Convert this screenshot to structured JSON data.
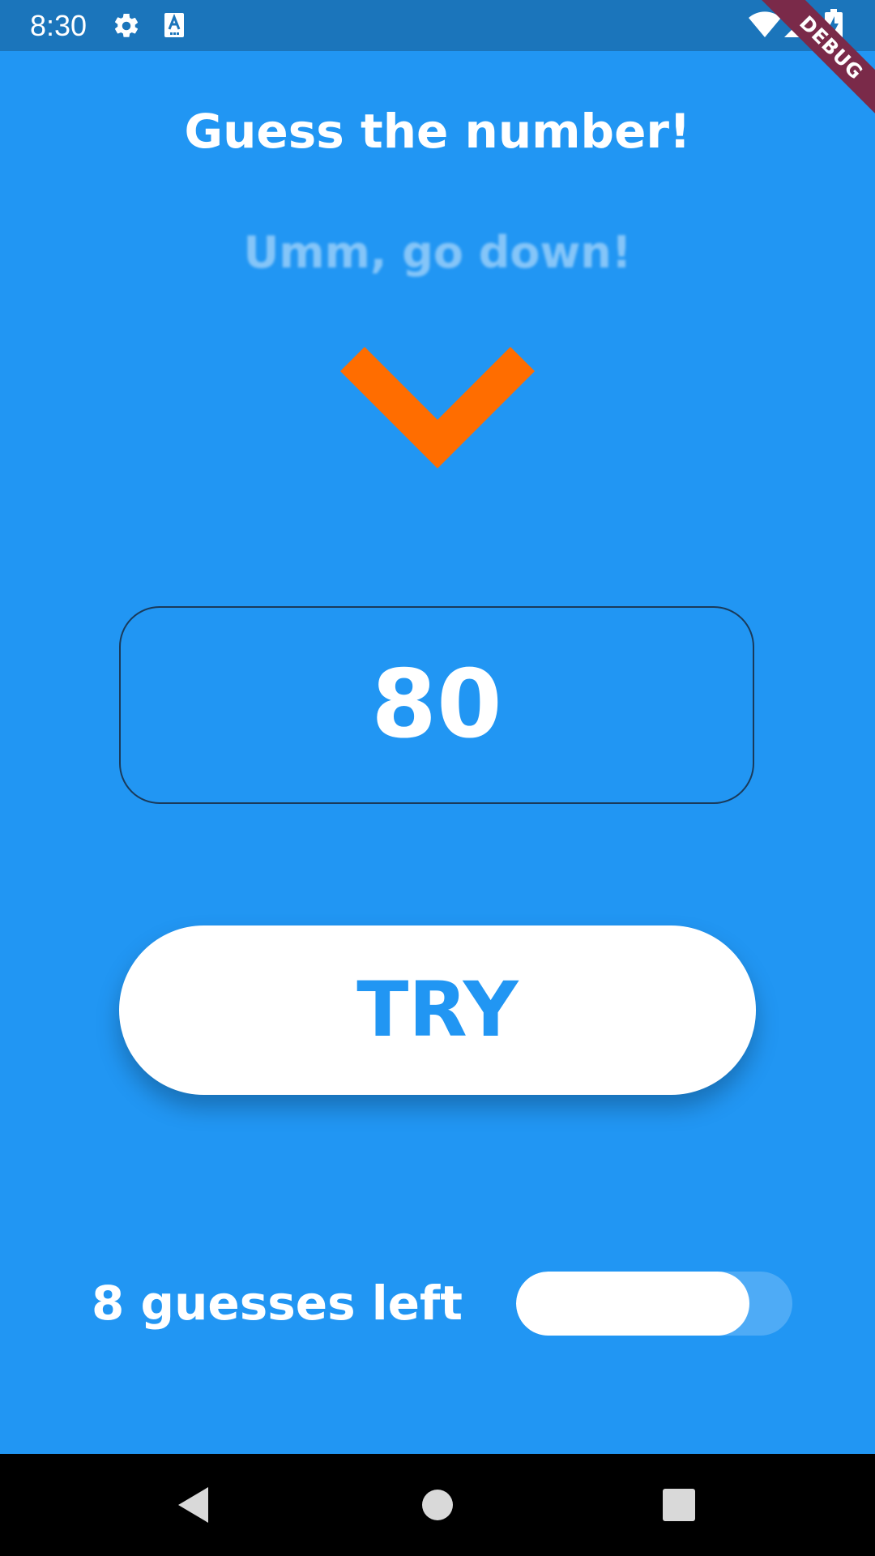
{
  "status_bar": {
    "time": "8:30",
    "icons": [
      "gear-icon",
      "keyboard-a-icon",
      "wifi-icon",
      "signal-icon",
      "battery-charging-icon"
    ]
  },
  "debug_banner": "DEBUG",
  "title": "Guess the number!",
  "hint": "Umm, go down!",
  "hint_icon": "chevron-down-icon",
  "guess_input": {
    "value": "80"
  },
  "try_button": {
    "label": "TRY"
  },
  "guesses": {
    "text": "8 guesses left",
    "remaining_fraction": 0.8
  },
  "nav_bar": {
    "icons": [
      "back-icon",
      "home-icon",
      "recents-icon"
    ]
  },
  "colors": {
    "background": "#2196F3",
    "status_bar": "#1B75BB",
    "accent_arrow": "#FF6D00",
    "button": "#FFFFFF",
    "button_text": "#2196F3",
    "debug_banner": "#7A2A49"
  }
}
